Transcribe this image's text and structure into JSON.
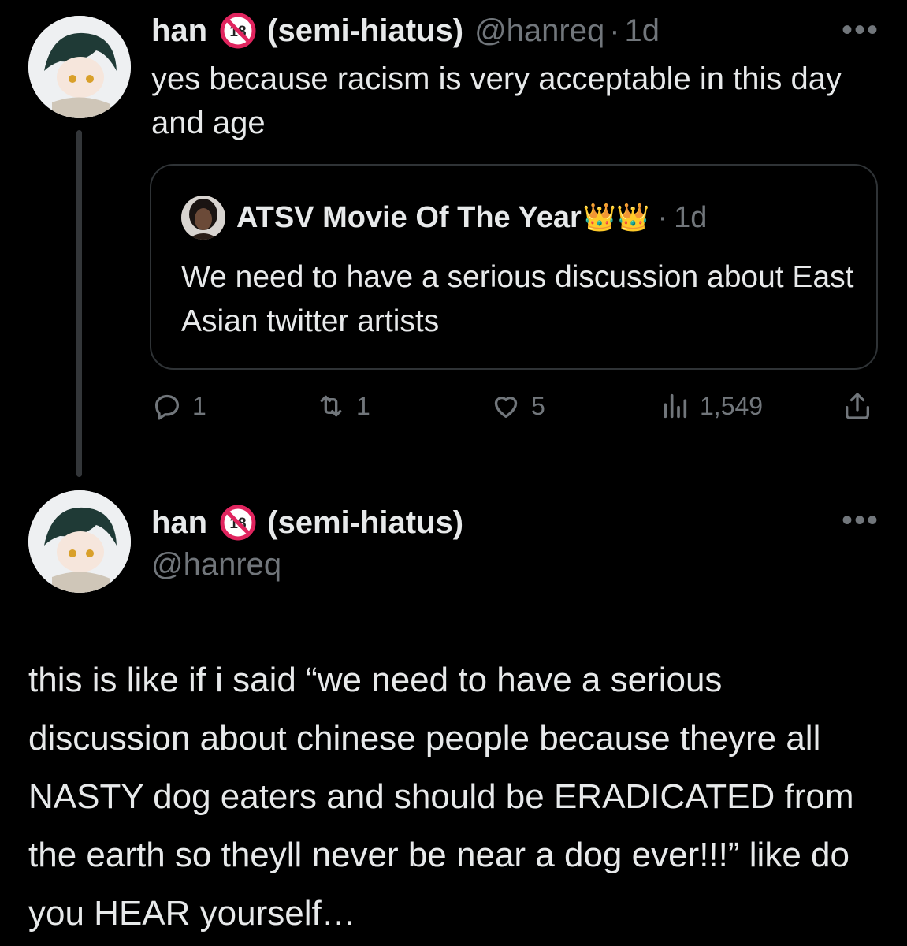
{
  "tweet1": {
    "display_name": "han",
    "badge": "18",
    "status": "(semi-hiatus)",
    "handle": "@hanreq",
    "separator": "·",
    "time": "1d",
    "more": "•••",
    "text": "yes because racism is very acceptable in this day and age",
    "quote": {
      "display_name": "ATSV Movie Of The Year",
      "emoji": "👑👑",
      "separator": "·",
      "time": "1d",
      "text": "We need to have a serious discussion about East Asian twitter artists"
    },
    "actions": {
      "replies": "1",
      "retweets": "1",
      "likes": "5",
      "views": "1,549"
    },
    "icons": [
      "reply-icon",
      "retweet-icon",
      "like-icon",
      "views-icon",
      "share-icon"
    ]
  },
  "tweet2": {
    "display_name": "han",
    "badge": "18",
    "status": "(semi-hiatus)",
    "handle": "@hanreq",
    "more": "•••",
    "text": "this is like if i said “we need to have a serious discussion about chinese people because theyre all NASTY dog eaters and should be ERADICATED from the earth so theyll never be near a dog ever!!!” like do you HEAR yourself…"
  },
  "colors": {
    "background": "#000000",
    "text": "#e7e9ea",
    "muted": "#71767b",
    "border": "#2f3336",
    "badge_red": "#e0245e"
  }
}
